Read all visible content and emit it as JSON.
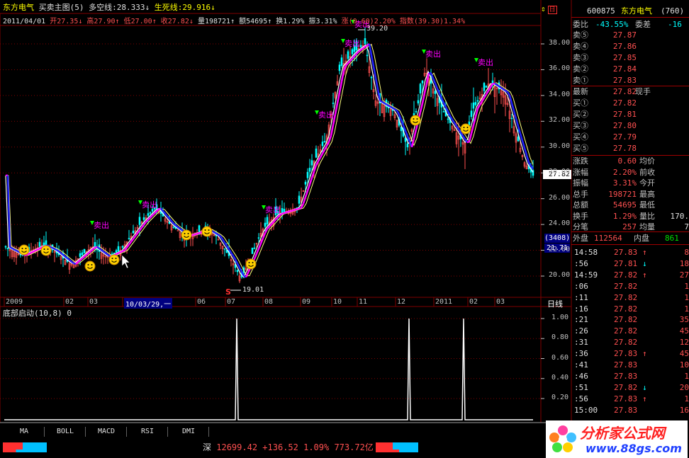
{
  "header": {
    "stock_name": "东方电气",
    "chart_name": "买卖主图(5)",
    "dkx_label": "多空线:",
    "dkx_value": "28.333",
    "dkx_arrow": "↓",
    "ssx_label": "生死线:",
    "ssx_value": "29.916",
    "ssx_arrow": "↓"
  },
  "quote_bar": {
    "date": "2011/04/01",
    "open_label": "开",
    "open": "27.35",
    "open_arrow": "↓",
    "high_label": "高",
    "high": "27.90",
    "high_arrow": "↑",
    "low_label": "低",
    "low": "27.00",
    "low_arrow": "↑",
    "close_label": "收",
    "close": "27.82",
    "close_arrow": "↓",
    "vol_label": "量",
    "vol": "198721",
    "vol_arrow": "↑",
    "amt_label": "额",
    "amt": "54695",
    "amt_arrow": "↑",
    "turn_label": "换",
    "turn": "1.29%",
    "amp_label": "振",
    "amp": "3.31%",
    "chg_label": "涨",
    "chg": "(0.60)2.20%",
    "idx_label": "指数",
    "idx": "(39.30)1.34%"
  },
  "main_chart": {
    "y_ticks": [
      "38.00",
      "36.00",
      "34.00",
      "32.00",
      "30.00",
      "28.00",
      "26.00",
      "24.00",
      "22.00",
      "20.00"
    ],
    "high_label": "39.20",
    "low_label": "19.01",
    "last_price_tag": "27.82",
    "volume_box": "(3408)",
    "volume_val": "21.71",
    "sell_label": "卖出",
    "buy_label": "S",
    "x_labels": [
      "2009",
      "02",
      "03",
      "10/03/29,一",
      "06",
      "07",
      "08",
      "09",
      "10",
      "11",
      "12",
      "2011",
      "02",
      "03"
    ],
    "period": "日线"
  },
  "sub_chart": {
    "title": "底部启动(10,8)",
    "value": "0",
    "y_ticks": [
      "1.00",
      "0.80",
      "0.60",
      "0.40",
      "0.20"
    ]
  },
  "right_panel": {
    "code": "600875",
    "name": "东方电气",
    "count": "(760)",
    "wb_label": "委比",
    "wb": "-43.55%",
    "wc_label": "委差",
    "wc": "-16",
    "asks": [
      {
        "label": "卖⑤",
        "price": "27.87"
      },
      {
        "label": "卖④",
        "price": "27.86"
      },
      {
        "label": "卖③",
        "price": "27.85"
      },
      {
        "label": "卖②",
        "price": "27.84"
      },
      {
        "label": "卖①",
        "price": "27.83"
      }
    ],
    "last_label": "最新",
    "last": "27.82",
    "now_label": "现手",
    "bids": [
      {
        "label": "买①",
        "price": "27.82"
      },
      {
        "label": "买②",
        "price": "27.81"
      },
      {
        "label": "买③",
        "price": "27.80"
      },
      {
        "label": "买④",
        "price": "27.79"
      },
      {
        "label": "买⑤",
        "price": "27.78"
      }
    ],
    "stats": [
      {
        "l1": "涨跌",
        "v1": "0.60",
        "l2": "均价",
        "v2": ""
      },
      {
        "l1": "涨幅",
        "v1": "2.20%",
        "l2": "前收",
        "v2": ""
      },
      {
        "l1": "振幅",
        "v1": "3.31%",
        "l2": "今开",
        "v2": ""
      },
      {
        "l1": "总手",
        "v1": "198721",
        "l2": "最高",
        "v2": ""
      },
      {
        "l1": "总额",
        "v1": "54695",
        "l2": "最低",
        "v2": ""
      },
      {
        "l1": "换手",
        "v1": "1.29%",
        "l2": "量比",
        "v2": "170."
      },
      {
        "l1": "分笔",
        "v1": "257",
        "l2": "均量",
        "v2": "7"
      }
    ],
    "outer_label": "外盘",
    "outer": "112564",
    "inner_label": "内盘",
    "inner": "861",
    "ticks": [
      {
        "t": "14:58",
        "p": "27.83",
        "a": "↑",
        "v": "8"
      },
      {
        "t": ":56",
        "p": "27.81",
        "a": "↓",
        "v": "18"
      },
      {
        "t": "14:59",
        "p": "27.82",
        "a": "↑",
        "v": "27"
      },
      {
        "t": ":06",
        "p": "27.82",
        "a": "",
        "v": "1"
      },
      {
        "t": ":11",
        "p": "27.82",
        "a": "",
        "v": "1"
      },
      {
        "t": ":16",
        "p": "27.82",
        "a": "",
        "v": "1"
      },
      {
        "t": ":21",
        "p": "27.82",
        "a": "",
        "v": "35"
      },
      {
        "t": ":26",
        "p": "27.82",
        "a": "",
        "v": "45"
      },
      {
        "t": ":31",
        "p": "27.82",
        "a": "",
        "v": "12"
      },
      {
        "t": ":36",
        "p": "27.83",
        "a": "↑",
        "v": "45"
      },
      {
        "t": ":41",
        "p": "27.83",
        "a": "",
        "v": "10"
      },
      {
        "t": ":46",
        "p": "27.83",
        "a": "",
        "v": "1"
      },
      {
        "t": ":51",
        "p": "27.82",
        "a": "↓",
        "v": "20"
      },
      {
        "t": ":56",
        "p": "27.83",
        "a": "↑",
        "v": "1"
      },
      {
        "t": "15:00",
        "p": "27.83",
        "a": "",
        "v": "16"
      }
    ]
  },
  "tabs": [
    "MA",
    "BOLL",
    "MACD",
    "RSI",
    "DMI"
  ],
  "status": {
    "market": "深",
    "index": "12699.42",
    "change": "+136.52",
    "pct": "1.09%",
    "amount": "773.72亿"
  },
  "watermark": {
    "text": "分析家公式网",
    "url": "www.88gs.com"
  },
  "colors": {
    "grid": "#800000",
    "up": "#ff5050",
    "down": "#00ffff",
    "dkx_up": "#ff00ff",
    "dkx_down": "#2020ff",
    "ma": "#ffffff",
    "ssx": "#ffff80"
  }
}
